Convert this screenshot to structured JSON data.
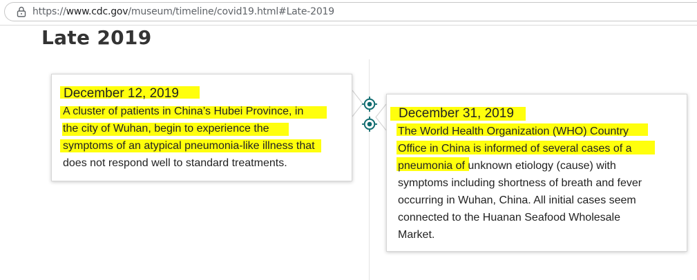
{
  "browser": {
    "url_scheme": "https://",
    "url_host": "www.cdc.gov",
    "url_path": "/museum/timeline/covid19.html#Late-2019"
  },
  "section": {
    "title": "Late 2019"
  },
  "events": [
    {
      "date": "December 12, 2019",
      "lines": [
        "A cluster of patients in China’s Hubei Province, in",
        "the city of Wuhan, begin to experience the",
        "symptoms of an atypical pneumonia-like illness that",
        "does not respond well to standard treatments."
      ]
    },
    {
      "date": "December 31, 2019",
      "lines": [
        "The World Health Organization (WHO) Country",
        "Office in China is informed of several cases of a",
        "pneumonia of unknown etiology (cause) with",
        "symptoms including shortness of breath and fever",
        "occurring in Wuhan, China. All initial cases seem",
        "connected to the Huanan Seafood Wholesale",
        "Market."
      ]
    }
  ],
  "colors": {
    "highlight": "#ffff00",
    "marker": "#0f6b6f",
    "timeline": "#e3e3e3"
  },
  "icons": [
    "lock-icon",
    "timeline-marker-icon"
  ]
}
